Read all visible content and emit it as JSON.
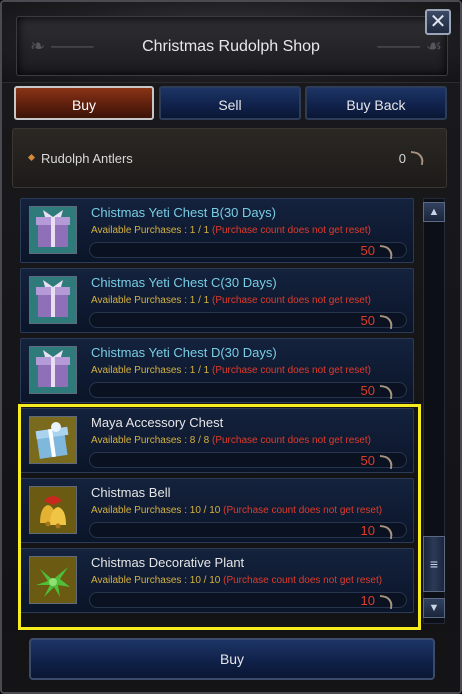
{
  "window": {
    "title": "Christmas Rudolph Shop",
    "close_label": "✕"
  },
  "tabs": [
    {
      "label": "Buy",
      "active": true
    },
    {
      "label": "Sell",
      "active": false
    },
    {
      "label": "Buy Back",
      "active": false
    }
  ],
  "currency": {
    "name": "Rudolph Antlers",
    "amount": "0",
    "icon": "antler-icon"
  },
  "items": [
    {
      "name": "Chistmas Yeti Chest B(30 Days)",
      "avail_label": "Available Purchases : 1 / 1",
      "avail_note": "(Purchase count does not get reset)",
      "price": "50",
      "icon": "purple-gift-icon"
    },
    {
      "name": "Chistmas Yeti Chest C(30 Days)",
      "avail_label": "Available Purchases : 1 / 1",
      "avail_note": "(Purchase count does not get reset)",
      "price": "50",
      "icon": "purple-gift-icon"
    },
    {
      "name": "Chistmas Yeti Chest D(30 Days)",
      "avail_label": "Available Purchases : 1 / 1",
      "avail_note": "(Purchase count does not get reset)",
      "price": "50",
      "icon": "purple-gift-icon"
    },
    {
      "name": "Maya Accessory Chest",
      "avail_label": "Available Purchases : 8 / 8",
      "avail_note": "(Purchase count does not get reset)",
      "price": "50",
      "icon": "blue-gift-icon"
    },
    {
      "name": "Chistmas Bell",
      "avail_label": "Available Purchases : 10 / 10",
      "avail_note": "(Purchase count does not get reset)",
      "price": "10",
      "icon": "bell-icon"
    },
    {
      "name": "Chistmas Decorative Plant",
      "avail_label": "Available Purchases : 10 / 10",
      "avail_note": "(Purchase count does not get reset)",
      "price": "10",
      "icon": "plant-icon"
    }
  ],
  "scrollbar": {
    "up_label": "▲",
    "down_label": "▼",
    "thumb_label": "≡"
  },
  "footer": {
    "buy_label": "Buy"
  },
  "colors": {
    "highlight": "#f7ec1e",
    "item_name": "#79cde6",
    "avail_label": "#d6b23f",
    "price": "#e03b2b"
  }
}
